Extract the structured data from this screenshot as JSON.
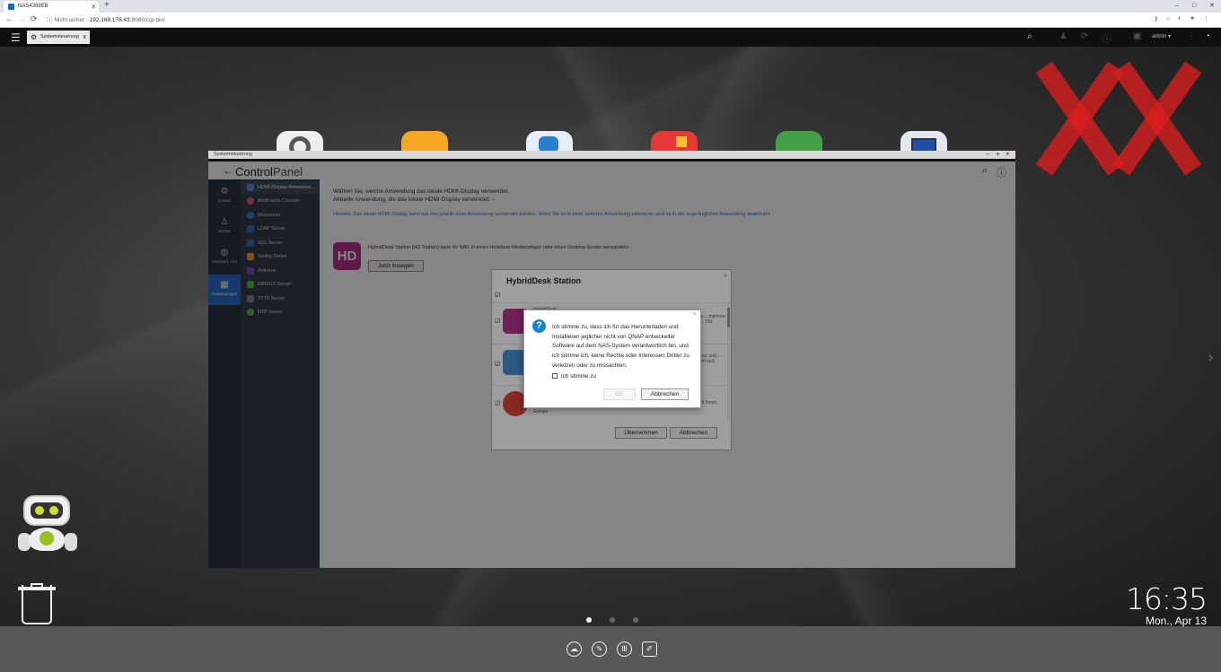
{
  "browser": {
    "tab_title": "NAS4388EB",
    "new_tab": "+",
    "window_controls": [
      "–",
      "□",
      "✕"
    ],
    "nav": [
      "←",
      "→",
      "⟳"
    ],
    "security_text": "Nicht sicher",
    "url_host": "192.168.178.43",
    "url_path": ":8080/cgi-bin/",
    "tab_close": "x"
  },
  "qts": {
    "menu_icon": "☰",
    "task_tab": "Systemsteuerung",
    "task_tab_close": "x",
    "user": "admin ▾",
    "icons": [
      "search-icon",
      "notification-icon",
      "sync-icon",
      "info-icon",
      "user-icon",
      "more-icon",
      "dashboard-icon"
    ]
  },
  "colors": {
    "accent": "#2c6fd1",
    "hd_brand": "#b4358d",
    "question_blue": "#1a7fd6"
  },
  "control_panel": {
    "window_title": "Systemsteuerung",
    "title_a": "Control",
    "title_b": "Panel",
    "categories": [
      {
        "label": "System",
        "icon": "gear-icon"
      },
      {
        "label": "Rechte",
        "icon": "user-icon"
      },
      {
        "label": "Netzwerk und",
        "icon": "network-icon"
      },
      {
        "label": "Anwendungen",
        "icon": "apps-icon"
      }
    ],
    "items": [
      {
        "label": "HDMI-Display-Anwendun..."
      },
      {
        "label": "Multimedia Console"
      },
      {
        "label": "Webserver"
      },
      {
        "label": "LDAP Server"
      },
      {
        "label": "SQL Server"
      },
      {
        "label": "Syslog Server"
      },
      {
        "label": "Antivirus"
      },
      {
        "label": "RADIUS Server"
      },
      {
        "label": "TFTP Server"
      },
      {
        "label": "NTP-Server"
      }
    ],
    "intro_line1": "Wählen Sie, welche Anwendung das lokale HDMI-Display verwendet.",
    "intro_line2": "Aktuelle Anwendung, die das lokale HDMI-Display verwendet: --",
    "hint": "Hinweis: Das lokale HDMI-Display kann nur von jeweils einer Anwendung verwendet werden. Wenn Sie es in einer anderen Anwendung aktivieren, wird es in der ursprünglichen Anwendung deaktiviert.",
    "hd_logo": "HD",
    "hd_desc": "HybridDesk Station (HD Station) kann Ihr NAS in einen Heimkino-Medienplayer oder einen Desktop-Ersatz verwandeln.",
    "start_button": "Jetzt loslegen"
  },
  "hd_dialog": {
    "title": "HybridDesk Station",
    "close": "×",
    "check": "☑",
    "app1_name": "HybridDesk",
    "app1_side": "s ... mehrere ... VM",
    "app2_side": "eos und ... ert sich",
    "app3_side": "ht Ihnen,",
    "app3_name": "Google",
    "apply": "Übernehmen",
    "cancel": "Abbrechen"
  },
  "agree_dialog": {
    "icon": "?",
    "close": "×",
    "text": "Ich stimme zu, dass ich für das Herunterladen und Installieren jeglicher nicht von QNAP entwickelter Software auf dem NAS-System verantwortlich bin, und ich stimme ich, keine Rechte oder Interessen Dritter zu verletzen oder zu missachten.",
    "checkbox_label": "Ich stimme zu",
    "ok": "OK",
    "cancel": "Abbrechen"
  },
  "desktop": {
    "time": "16:35",
    "date": "Mon., Apr 13",
    "dock_icons": [
      "cloud-icon",
      "tools-icon",
      "library-icon",
      "notes-icon"
    ]
  }
}
